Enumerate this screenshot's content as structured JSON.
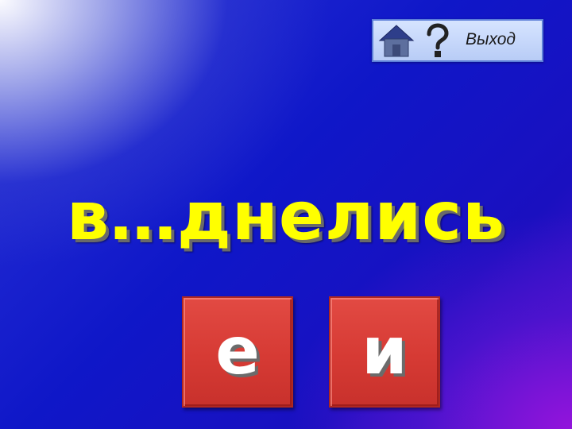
{
  "nav": {
    "home_icon": "home-icon",
    "help_icon": "question-mark-icon",
    "exit_label": "Выход"
  },
  "task": {
    "word": "в…днелись"
  },
  "answers": [
    {
      "letter": "е"
    },
    {
      "letter": "и"
    }
  ],
  "colors": {
    "word_color": "#ffff00",
    "answer_button_color": "#d63a34",
    "nav_panel_color": "#c8d8fb",
    "background_color": "#0f17c8"
  }
}
